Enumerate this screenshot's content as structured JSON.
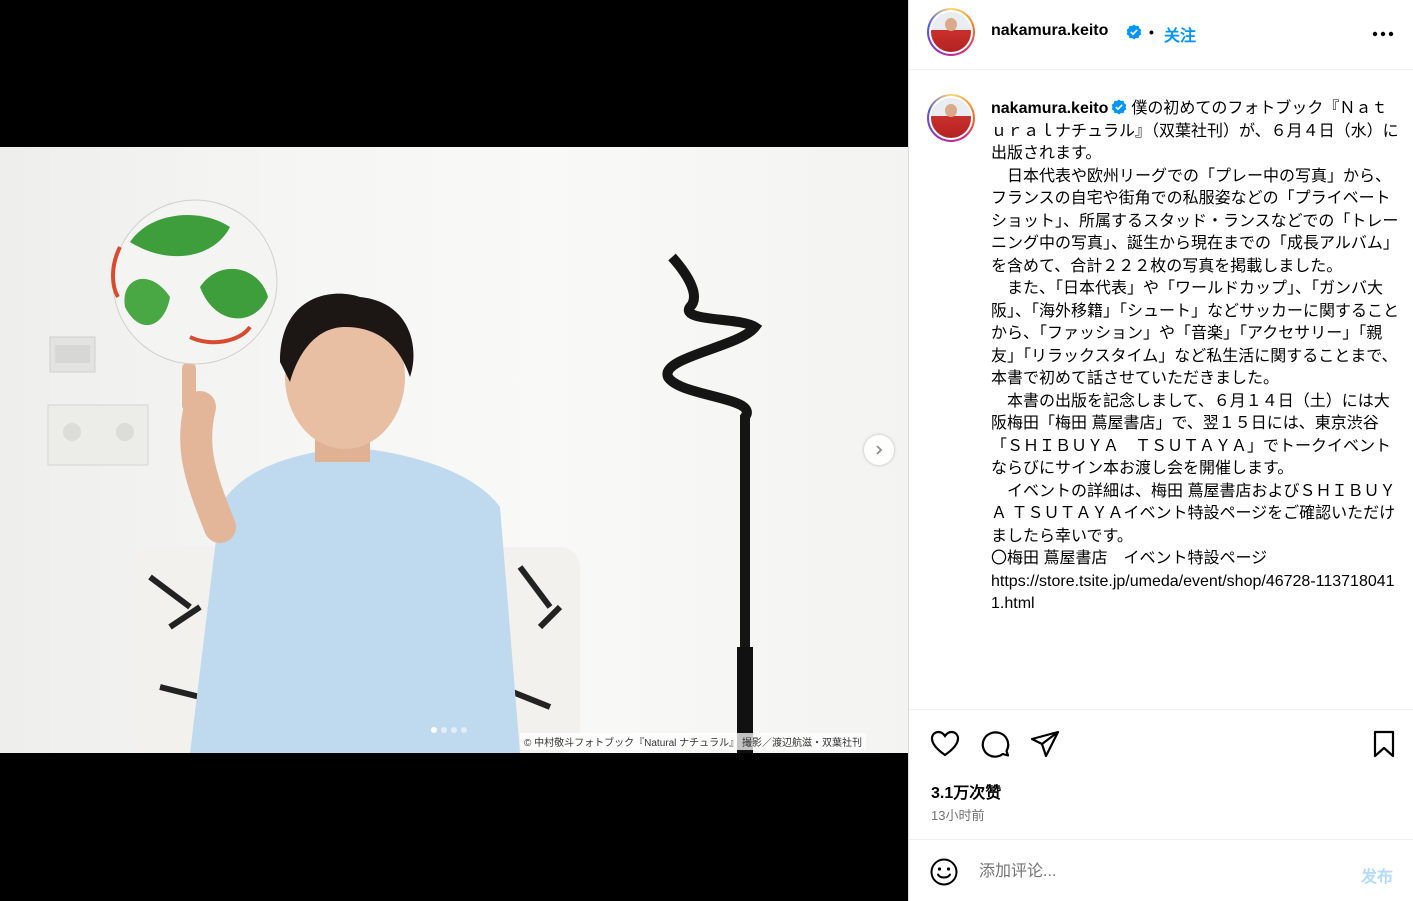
{
  "post": {
    "image_credit": "© 中村敬斗フォトブック『Natural ナチュラル』 撮影／渡辺航滋・双葉社刊",
    "carousel_dots": 4,
    "active_slide": 1,
    "next_icon": "chevron-right-icon"
  },
  "header": {
    "username": "nakamura.keito",
    "separator": "•",
    "follow_label": "关注",
    "more_icon": "more-horizontal-icon"
  },
  "caption": {
    "username": "nakamura.keito",
    "text": "僕の初めてのフォトブック『Ｎａｔｕｒａｌナチュラル』（双葉社刊）が、６月４日（水）に出版されます。\n　日本代表や欧州リーグでの「プレー中の写真」から、フランスの自宅や街角での私服姿などの「プライベートショット」、所属するスタッド・ランスなどでの「トレーニング中の写真」、誕生から現在までの「成長アルバム」を含めて、合計２２２枚の写真を掲載しました。\n　また、「日本代表」や「ワールドカップ」、「ガンバ大阪」、「海外移籍」「シュート」などサッカーに関することから、「ファッション」や「音楽」「アクセサリー」「親友」「リラックスタイム」など私生活に関することまで、本書で初めて話させていただきました。\n　本書の出版を記念しまして、６月１４日（土）には大阪梅田「梅田 蔦屋書店」で、翌１５日には、東京渋谷「ＳＨＩＢＵＹＡ　ＴＳＵＴＡＹＡ」でトークイベントならびにサイン本お渡し会を開催します。\n　イベントの詳細は、梅田 蔦屋書店およびＳＨＩＢＵＹＡ ＴＳＵＴＡＹＡイベント特設ページをご確認いただけましたら幸いです。\n〇梅田 蔦屋書店　イベント特設ページ\nhttps://store.tsite.jp/umeda/event/shop/46728-1137180411.html"
  },
  "actions": {
    "like_icon": "heart-icon",
    "comment_icon": "comment-icon",
    "share_icon": "send-icon",
    "save_icon": "bookmark-icon"
  },
  "stats": {
    "likes": "3.1万次赞",
    "time": "13小时前"
  },
  "comment": {
    "placeholder": "添加评论...",
    "post_label": "发布",
    "emoji_icon": "emoji-icon"
  },
  "colors": {
    "accent": "#0095f6",
    "muted": "#737373",
    "post_disabled": "#b3dbff"
  }
}
